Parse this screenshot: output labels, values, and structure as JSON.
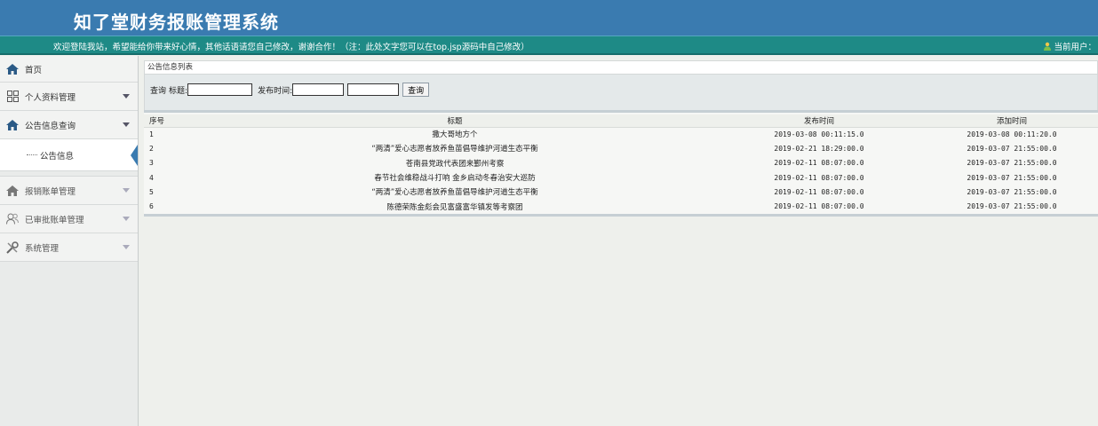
{
  "header": {
    "app_title": "知了堂财务报账管理系统",
    "marquee": "欢迎登陆我站，希望能给你带来好心情，其他话语请您自己修改，谢谢合作！（注：此处文字您可以在top.jsp源码中自己修改）",
    "current_user_label": "当前用户："
  },
  "sidebar": {
    "home": {
      "label": "首页",
      "icon": "home-icon"
    },
    "items": [
      {
        "label": "个人资料管理",
        "icon": "grid-icon"
      },
      {
        "label": "公告信息查询",
        "icon": "home-icon"
      },
      {
        "label": "报销账单管理",
        "icon": "home-icon"
      },
      {
        "label": "已审批账单管理",
        "icon": "users-icon"
      },
      {
        "label": "系统管理",
        "icon": "tools-icon"
      }
    ],
    "sub_items": [
      {
        "label": "公告信息",
        "active": true
      }
    ]
  },
  "main": {
    "panel_title": "公告信息列表",
    "search": {
      "query_label": "查询",
      "title_label": "标题:",
      "title_value": "",
      "publish_time_label": "发布时间:",
      "start_value": "",
      "end_value": "",
      "submit_label": "查询"
    },
    "table": {
      "columns": [
        "序号",
        "标题",
        "发布时间",
        "添加时间"
      ],
      "rows": [
        [
          "1",
          "撒大哥地方个",
          "2019-03-08 00:11:15.0",
          "2019-03-08 00:11:20.0"
        ],
        [
          "2",
          "“两清”爱心志愿者放养鱼苗倡导维护河道生态平衡",
          "2019-02-21 18:29:00.0",
          "2019-03-07 21:55:00.0"
        ],
        [
          "3",
          "苍南县党政代表团来鄞州考察",
          "2019-02-11 08:07:00.0",
          "2019-03-07 21:55:00.0"
        ],
        [
          "4",
          "春节社会维稳战斗打响 金乡启动冬春治安大巡防",
          "2019-02-11 08:07:00.0",
          "2019-03-07 21:55:00.0"
        ],
        [
          "5",
          "“两清”爱心志愿者放养鱼苗倡导维护河道生态平衡",
          "2019-02-11 08:07:00.0",
          "2019-03-07 21:55:00.0"
        ],
        [
          "6",
          "陈德荣陈金彪会见富盛富华镇发等考察团",
          "2019-02-11 08:07:00.0",
          "2019-03-07 21:55:00.0"
        ]
      ]
    }
  },
  "colors": {
    "header_bg": "#3a7bb0",
    "marquee_bg": "#1e8a86",
    "accent": "#3a7bb0",
    "sidebar_bg": "#e9ebea"
  }
}
